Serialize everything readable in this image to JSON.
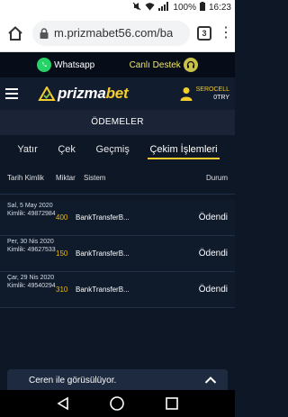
{
  "statusbar": {
    "battery": "100%",
    "time": "16:23"
  },
  "browser": {
    "url": "m.prizmabet56.com/ba",
    "tab_count": "3"
  },
  "contacts": {
    "whatsapp_label": "Whatsapp",
    "live_support_label": "Canlı Destek"
  },
  "header": {
    "logo_part1": "prizma",
    "logo_part2": "bet",
    "username": "SEROCELL",
    "balance": "0TRY"
  },
  "page_title": "ÖDEMELER",
  "tabs": [
    {
      "label": "Yatır"
    },
    {
      "label": "Çek"
    },
    {
      "label": "Geçmiş"
    },
    {
      "label": "Çekim İşlemleri"
    }
  ],
  "table": {
    "headers": {
      "date_kimlik": "Tarih Kimlik",
      "amount": "Miktar",
      "system": "Sistem",
      "status": "Durum"
    },
    "rows": [
      {
        "date": "Sal, 5 May 2020",
        "kimlik": "Kimlik: 49872984",
        "amount": "400",
        "system": "BankTransferB...",
        "status": "Ödendi"
      },
      {
        "date": "Per, 30 Nis 2020",
        "kimlik": "Kimlik: 49627533",
        "amount": "150",
        "system": "BankTransferB...",
        "status": "Ödendi"
      },
      {
        "date": "Çar, 29 Nis 2020",
        "kimlik": "Kimlik: 49540294",
        "amount": "310",
        "system": "BankTransferB...",
        "status": "Ödendi"
      }
    ]
  },
  "chat": {
    "label": "Ceren ile görüsülüyor."
  },
  "colors": {
    "accent": "#f3cd2d",
    "background": "#0e1726",
    "amount": "#f0b90b",
    "whatsapp": "#25d366"
  }
}
